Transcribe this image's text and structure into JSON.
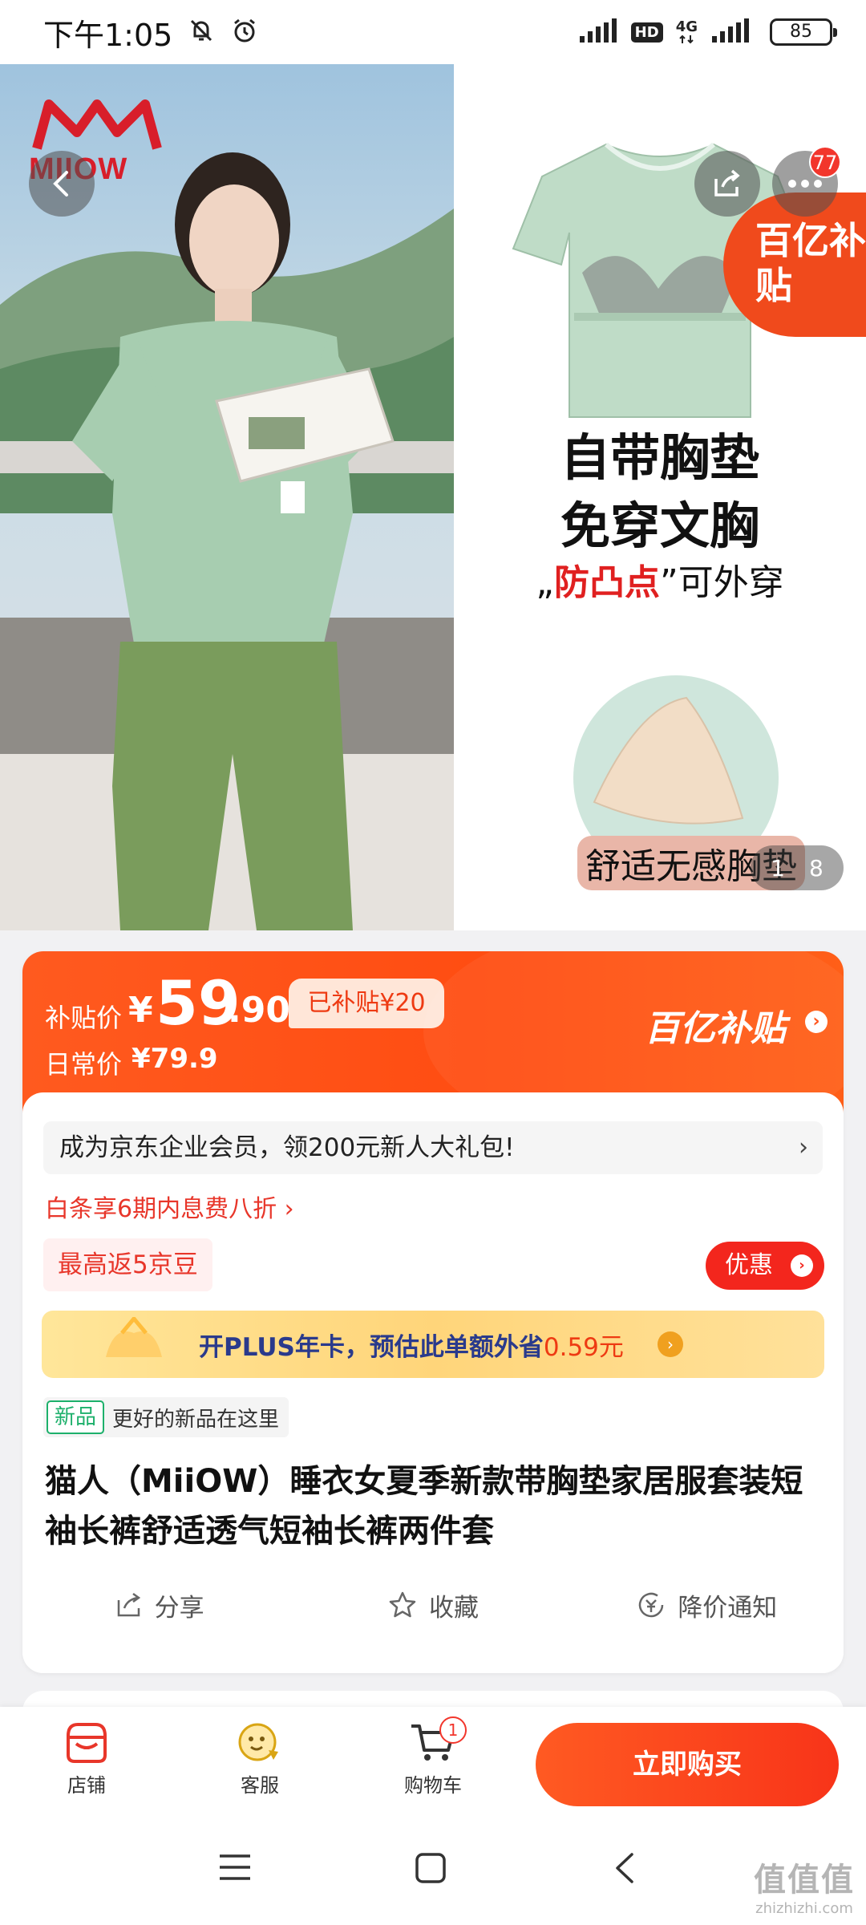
{
  "status_bar": {
    "time": "下午1:05",
    "hd": "HD",
    "network": "4G",
    "battery": "85"
  },
  "gallery": {
    "brand": "MIIOW",
    "feature_line1": "自带胸垫",
    "feature_line2": "免穿文胸",
    "feature_line3_quote_open": "„",
    "feature_line3_red": "防凸点",
    "feature_line3_rest": "”可外穿",
    "pad_label": "舒适无感胸垫",
    "subsidy_corner": "百亿补贴",
    "more_badge": "77",
    "page_current": "1",
    "page_total": "8"
  },
  "price": {
    "subsidy_label": "补贴价",
    "currency": "¥",
    "price_int": "59",
    "price_dec": ".90",
    "subsidized": "已补贴¥20",
    "daily_label": "日常价",
    "daily_price": "¥79.9",
    "subsidy_brand": "百亿补贴"
  },
  "promos": {
    "member": "成为京东企业会员，领200元新人大礼包!",
    "member_chevron": "›",
    "baitiao": "白条享6期内息费八折 ›",
    "jingdou": "最高返5京豆",
    "discount": "优惠",
    "plus_text": "开PLUS年卡，预估此单额外省",
    "plus_amount": "0.59元"
  },
  "product": {
    "new_badge": "新品",
    "new_text": "更好的新品在这里",
    "title": "猫人（MiiOW）睡衣女夏季新款带胸垫家居服套装短袖长裤舒适透气短袖长裤两件套"
  },
  "actions": {
    "share": "分享",
    "favorite": "收藏",
    "price_alert": "降价通知"
  },
  "bottom_bar": {
    "store": "店铺",
    "service": "客服",
    "cart": "购物车",
    "cart_count": "1",
    "buy": "立即购买"
  },
  "watermark": {
    "big": "值值值",
    "small": "zhizhizhi.com"
  },
  "colors": {
    "accent": "#ff4d12",
    "red": "#e8362a",
    "plus_text": "#2a3a8c",
    "new_green": "#1db06b"
  }
}
